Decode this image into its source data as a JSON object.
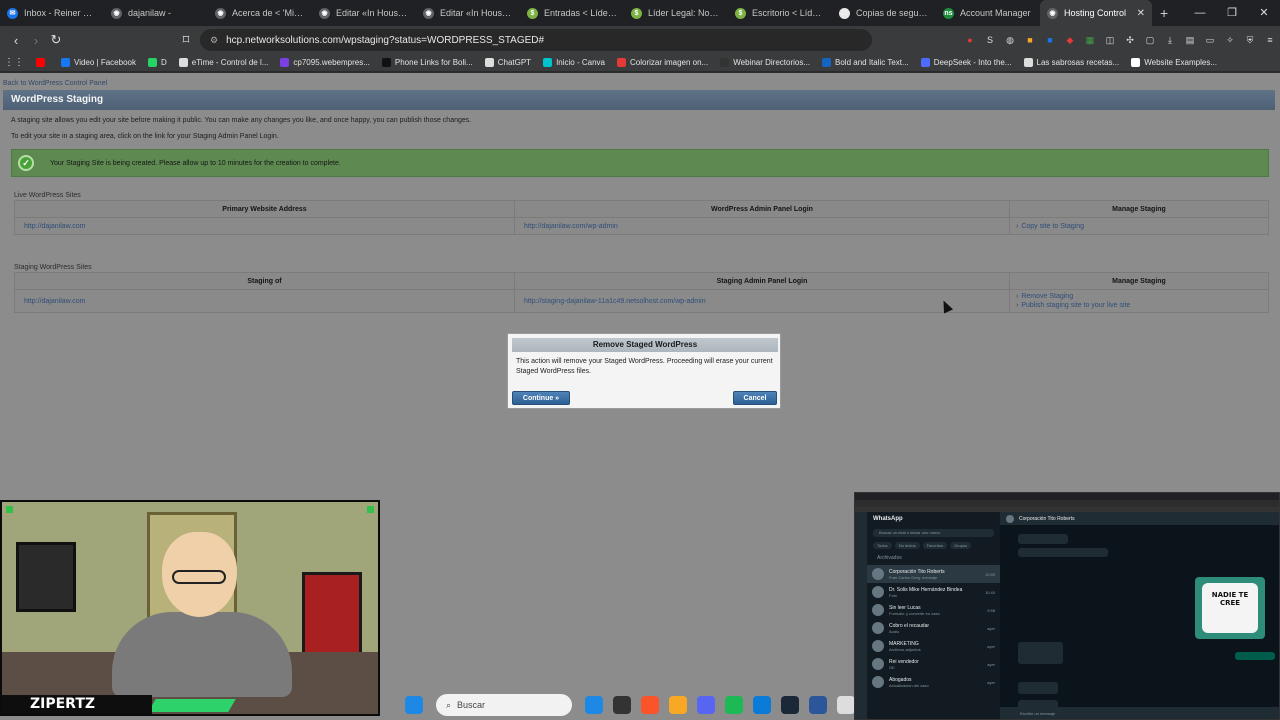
{
  "browser": {
    "tabs": [
      {
        "label": "Inbox - Reiner Solis",
        "color": "#1a73e8",
        "glyph": "✉"
      },
      {
        "label": "dajanilaw -",
        "color": "#5f6368",
        "glyph": "◉"
      },
      {
        "label": "Acerca de < 'Mi Sitio'",
        "color": "#5f6368",
        "glyph": "◉"
      },
      {
        "label": "Editar «In House ho",
        "color": "#5f6368",
        "glyph": "◉"
      },
      {
        "label": "Editar «In House ho",
        "color": "#5f6368",
        "glyph": "◉"
      },
      {
        "label": "Entradas < Líder Le",
        "color": "#7cb342",
        "glyph": "$"
      },
      {
        "label": "Líder Legal: Noticias",
        "color": "#7cb342",
        "glyph": "$"
      },
      {
        "label": "Escritorio < Líder Le",
        "color": "#7cb342",
        "glyph": "$"
      },
      {
        "label": "Copias de seguridad",
        "color": "#e8e8e8",
        "glyph": "□"
      },
      {
        "label": "Account Manager",
        "color": "#1e8e3e",
        "glyph": "ns"
      },
      {
        "label": "Hosting Control",
        "color": "#5f6368",
        "glyph": "◉",
        "active": true
      }
    ],
    "new_tab_glyph": "+",
    "window_controls": {
      "minimize": "—",
      "maximize": "❐",
      "close": "✕"
    },
    "url": "hcp.networksolutions.com/wpstaging?status=WORDPRESS_STAGED#",
    "bookmarks": [
      {
        "label": "",
        "color": "#ff0000"
      },
      {
        "label": "Video | Facebook",
        "color": "#1877f2"
      },
      {
        "label": "D",
        "color": "#25d366"
      },
      {
        "label": "eTime - Control de l...",
        "color": "#dddddd"
      },
      {
        "label": "cp7095.webempres...",
        "color": "#7b3fe4"
      },
      {
        "label": "Phone Links for Boli...",
        "color": "#111111"
      },
      {
        "label": "ChatGPT",
        "color": "#dddddd"
      },
      {
        "label": "Inicio - Canva",
        "color": "#00c4cc"
      },
      {
        "label": "Colorizar imagen on...",
        "color": "#e53935"
      },
      {
        "label": "Webinar Directorios...",
        "color": "#333333"
      },
      {
        "label": "Bold and Italic Text...",
        "color": "#1565c0"
      },
      {
        "label": "DeepSeek - Into the...",
        "color": "#4d6bfe"
      },
      {
        "label": "Las sabrosas recetas...",
        "color": "#dddddd"
      },
      {
        "label": "Website Examples...",
        "color": "#ffffff"
      }
    ]
  },
  "page": {
    "back_link": "Back to WordPress Control Panel",
    "title": "WordPress Staging",
    "desc1": "A staging site allows you edit your site before making it public.  You can make any changes you like, and once happy, you can publish those changes.",
    "desc2": "To edit your site in a staging area, click on the link for your Staging Admin Panel Login.",
    "success": "Your Staging Site is being created. Please allow up to 10 minutes for the creation to complete.",
    "live_section": "Live WordPress Sites",
    "live_headers": [
      "Primary Website Address",
      "WordPress Admin Panel Login",
      "Manage Staging"
    ],
    "live_row": {
      "address": "http://dajanilaw.com",
      "admin": "http://dajanilaw.com/wp-admin",
      "action": "Copy site to Staging"
    },
    "staging_section": "Staging WordPress Sites",
    "staging_headers": [
      "Staging of",
      "Staging Admin Panel Login",
      "Manage Staging"
    ],
    "staging_row": {
      "address": "http://dajanilaw.com",
      "admin": "http://staging-dajanilaw-11a1c49.netsolhost.com/wp-admin",
      "action1": "Remove Staging",
      "action2": "Publish staging site to your live site"
    }
  },
  "modal": {
    "title": "Remove Staged WordPress",
    "body": "This action will remove your Staged WordPress. Proceeding will erase your current Staged WordPress files.",
    "continue": "Continue »",
    "cancel": "Cancel"
  },
  "overlay": {
    "streamer_name": "ZIPERTZ"
  },
  "taskbar": {
    "search_placeholder": "Buscar",
    "icons": [
      "#1e88e5",
      "#333333",
      "#fb542b",
      "#f9a825",
      "#5865f2",
      "#1db954",
      "#0a7cd8",
      "#1b2838",
      "#2b579a",
      "#dddddd"
    ]
  },
  "whatsapp": {
    "title": "WhatsApp",
    "search": "Buscar un chat o iniciar uno nuevo",
    "filters": [
      "Todos",
      "No leídos",
      "Favoritos",
      "Grupos"
    ],
    "archived": "Archivados",
    "chats": [
      {
        "name": "Corporación Tito Roberts",
        "preview": "Fran Carlos Greg: mensaje",
        "time": "10:55"
      },
      {
        "name": "Dr. Solis Mike Hernández Bindea",
        "preview": "Foto",
        "time": "10:40"
      },
      {
        "name": "Sin leer Lucas",
        "preview": "Formato: y convertir en caso",
        "time": "9:58"
      },
      {
        "name": "Cobro el recaudar",
        "preview": "Audio",
        "time": "ayer"
      },
      {
        "name": "MARKETING",
        "preview": "Archivos adjuntos",
        "time": "ayer"
      },
      {
        "name": "Rei vendedor",
        "preview": "OK",
        "time": "ayer"
      },
      {
        "name": "Abogados",
        "preview": "Actualización del caso",
        "time": "ayer"
      }
    ],
    "conversation_name": "Corporación Tito Roberts",
    "sticker_text": "NADIE TE CREE",
    "input_placeholder": "Escribe un mensaje"
  }
}
